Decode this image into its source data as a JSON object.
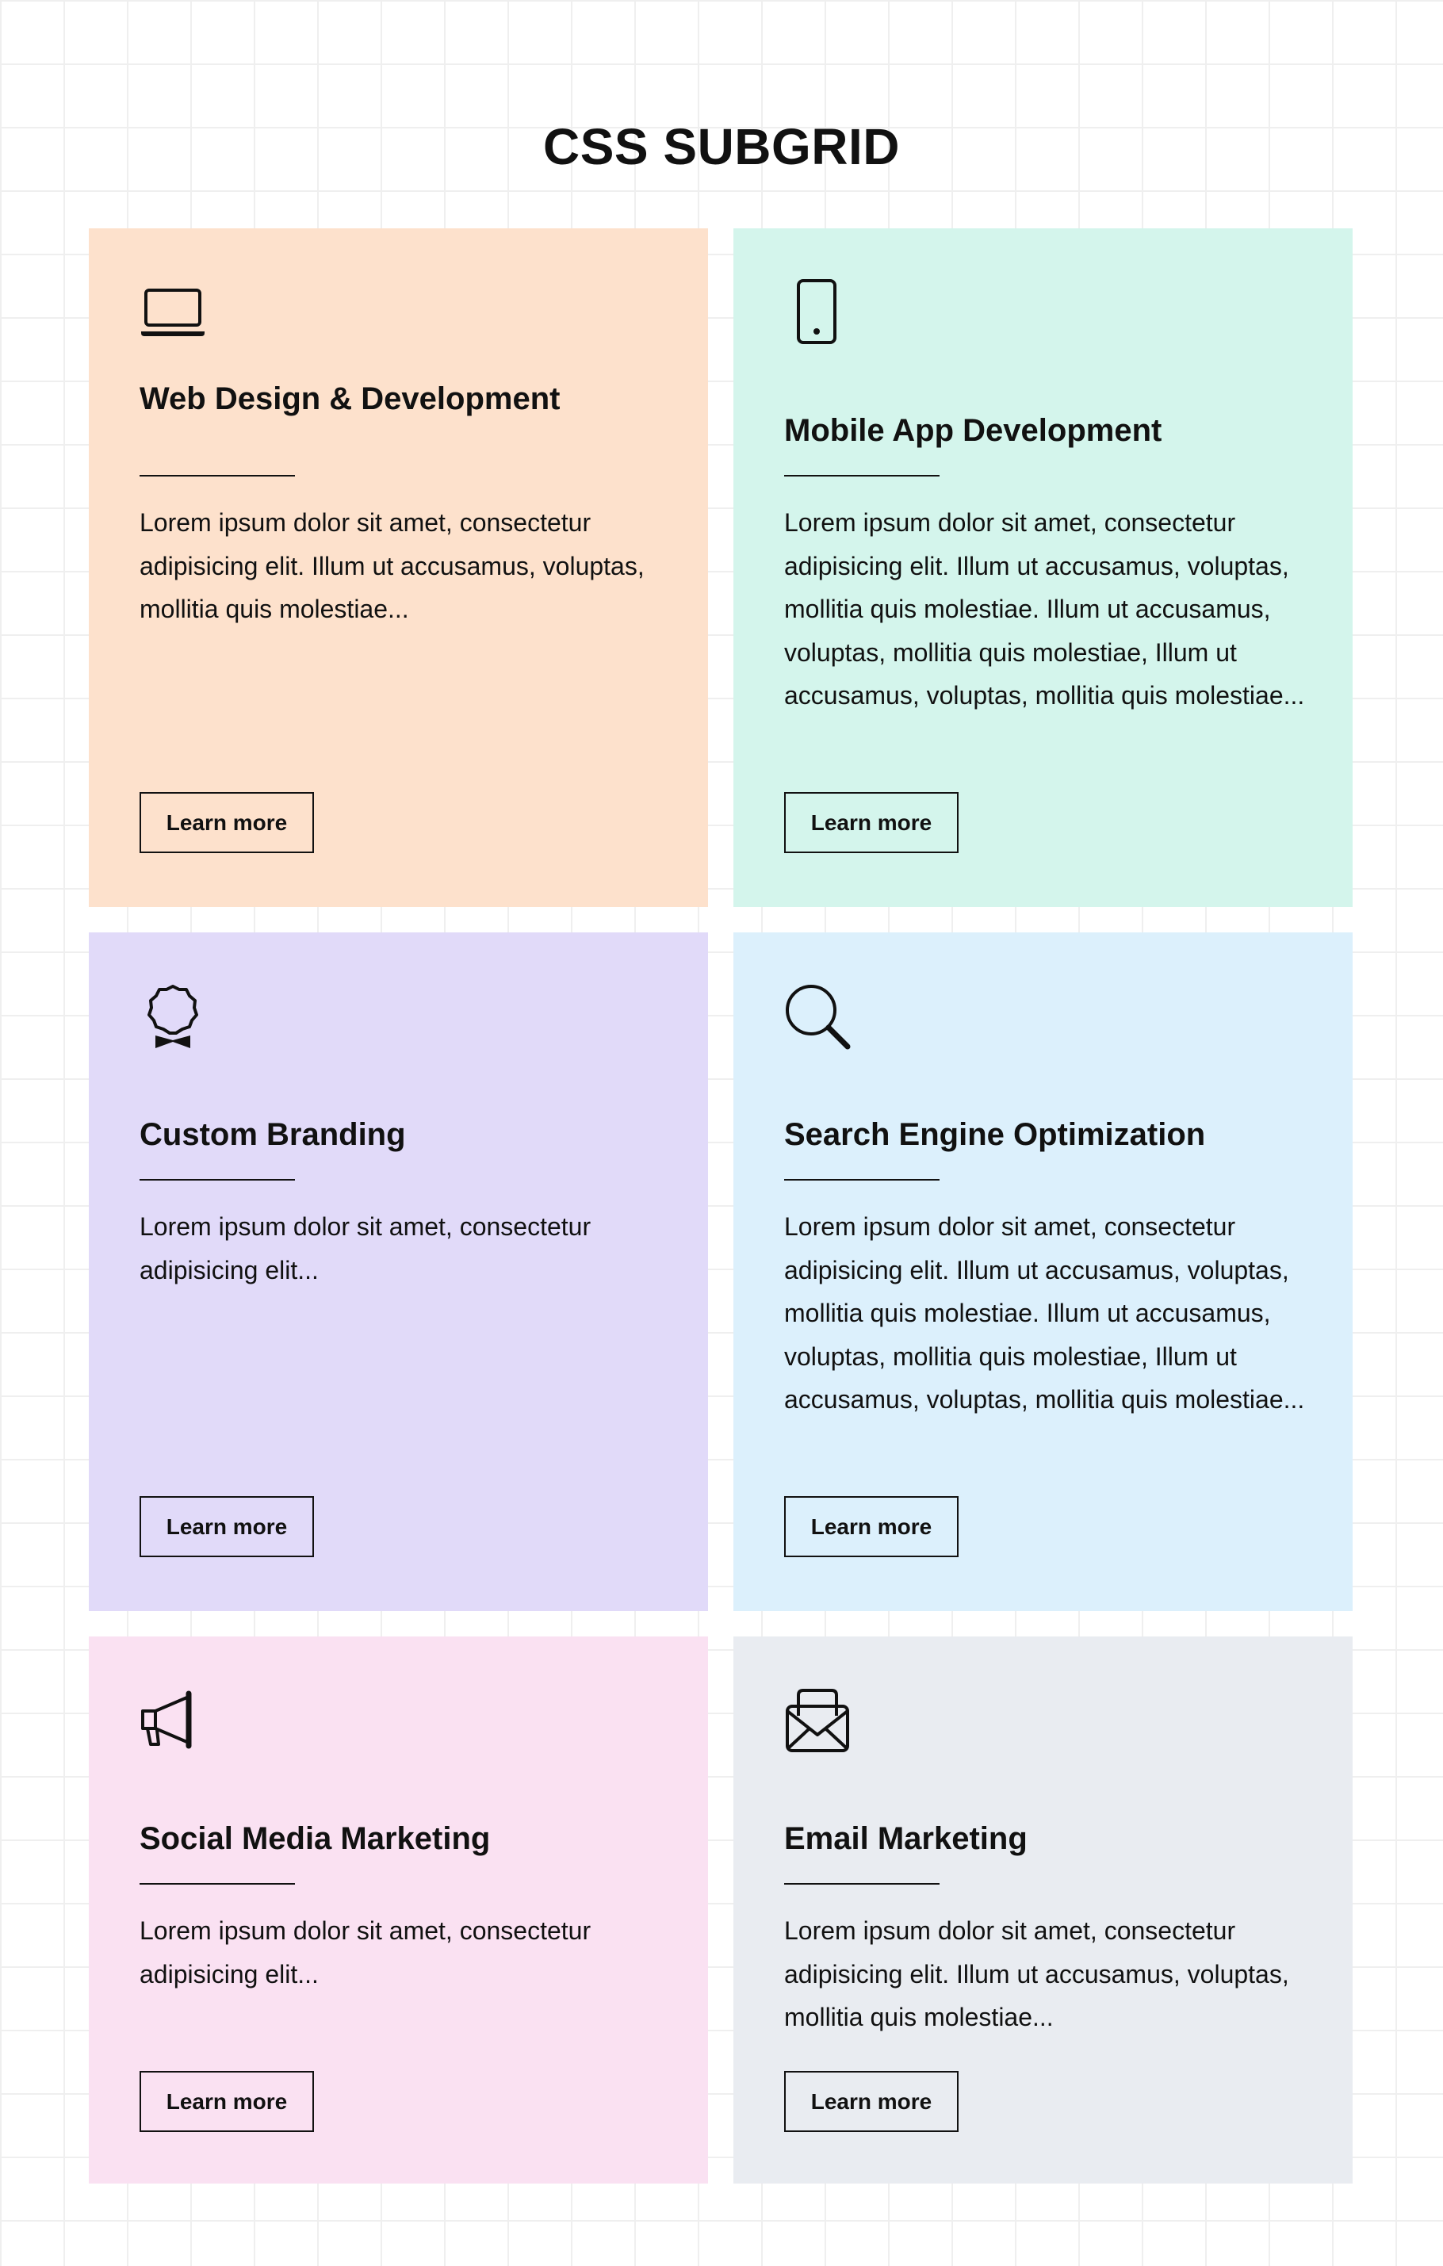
{
  "page": {
    "title": "CSS SUBGRID"
  },
  "cards": [
    {
      "icon": "laptop-icon",
      "title": "Web Design & Development",
      "body": "Lorem ipsum dolor sit amet, consectetur adipisicing elit. Illum ut accusamus, voluptas, mollitia quis molestiae...",
      "button": "Learn more",
      "color": "#fde1cc"
    },
    {
      "icon": "phone-icon",
      "title": "Mobile App Development",
      "body": "Lorem ipsum dolor sit amet, consectetur adipisicing elit. Illum ut accusamus, voluptas, mollitia quis molestiae. Illum ut accusamus, voluptas, mollitia quis molestiae, Illum ut accusamus, voluptas, mollitia quis molestiae...",
      "button": "Learn more",
      "color": "#d4f5ec"
    },
    {
      "icon": "award-ribbon-icon",
      "title": "Custom Branding",
      "body": "Lorem ipsum dolor sit amet, consectetur adipisicing elit...",
      "button": "Learn more",
      "color": "#e1daf9"
    },
    {
      "icon": "search-icon",
      "title": "Search Engine Optimization",
      "body": "Lorem ipsum dolor sit amet, consectetur adipisicing elit. Illum ut accusamus, voluptas, mollitia quis molestiae. Illum ut accusamus, voluptas, mollitia quis molestiae, Illum ut accusamus, voluptas, mollitia quis molestiae...",
      "button": "Learn more",
      "color": "#dcf0fc"
    },
    {
      "icon": "megaphone-icon",
      "title": "Social Media Marketing",
      "body": "Lorem ipsum dolor sit amet, consectetur adipisicing elit...",
      "button": "Learn more",
      "color": "#fae1f2"
    },
    {
      "icon": "envelope-open-icon",
      "title": "Email Marketing",
      "body": "Lorem ipsum dolor sit amet, consectetur adipisicing elit. Illum ut accusamus, voluptas, mollitia quis molestiae...",
      "button": "Learn more",
      "color": "#e9ecf1"
    }
  ]
}
